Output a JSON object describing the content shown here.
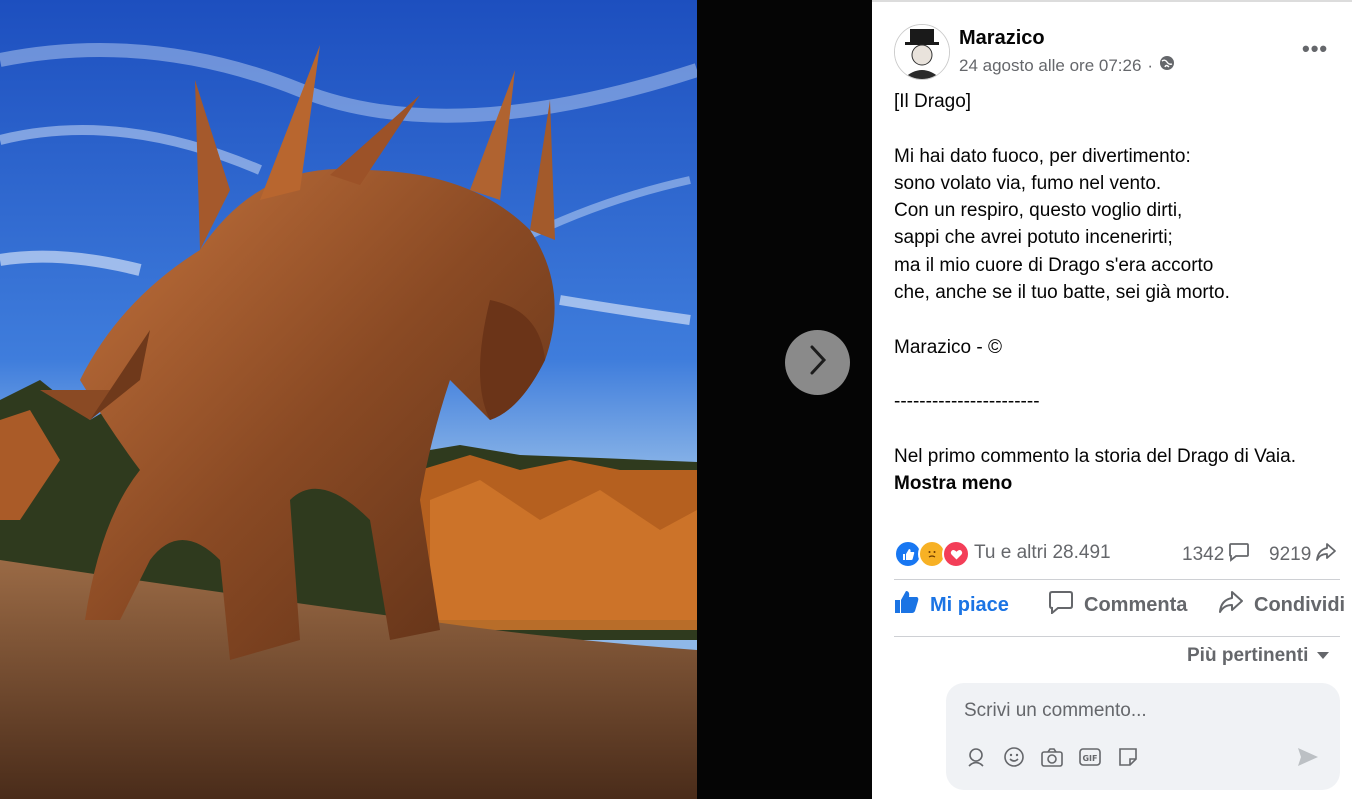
{
  "post": {
    "author": "Marazico",
    "date": "24 agosto alle ore 07:26",
    "separator": "·",
    "lines": [
      "[Il Drago]",
      "",
      "Mi hai dato fuoco, per divertimento:",
      "sono volato via, fumo nel vento.",
      "Con un respiro, questo voglio dirti,",
      "sappi che avrei potuto incenerirti;",
      "ma il mio cuore di Drago s'era accorto",
      "che, anche se il tuo batte, sei già morto.",
      "",
      "Marazico - ©",
      "",
      "-----------------------",
      "",
      "Nel primo commento la storia del Drago di Vaia."
    ],
    "see_less": "Mostra meno"
  },
  "stats": {
    "reactions_text": "Tu e altri 28.491",
    "comments": "1342",
    "shares": "9219"
  },
  "actions": {
    "like": "Mi piace",
    "comment": "Commenta",
    "share": "Condividi"
  },
  "sort_label": "Più pertinenti",
  "composer": {
    "placeholder": "Scrivi un commento..."
  },
  "icons": {
    "next": "chevron-right-icon",
    "privacy": "globe-icon",
    "more": "more-horizontal-icon",
    "reactions": [
      "like-reaction-icon",
      "care-reaction-icon",
      "love-reaction-icon"
    ],
    "composer_tools": [
      "avatar-sticker-icon",
      "emoji-icon",
      "camera-icon",
      "gif-icon",
      "sticker-icon"
    ],
    "send": "send-icon"
  },
  "colors": {
    "accent": "#1b74e4",
    "muted": "#65676b",
    "like": "#1877f2",
    "love": "#f33e58",
    "care": "#f7b125"
  }
}
